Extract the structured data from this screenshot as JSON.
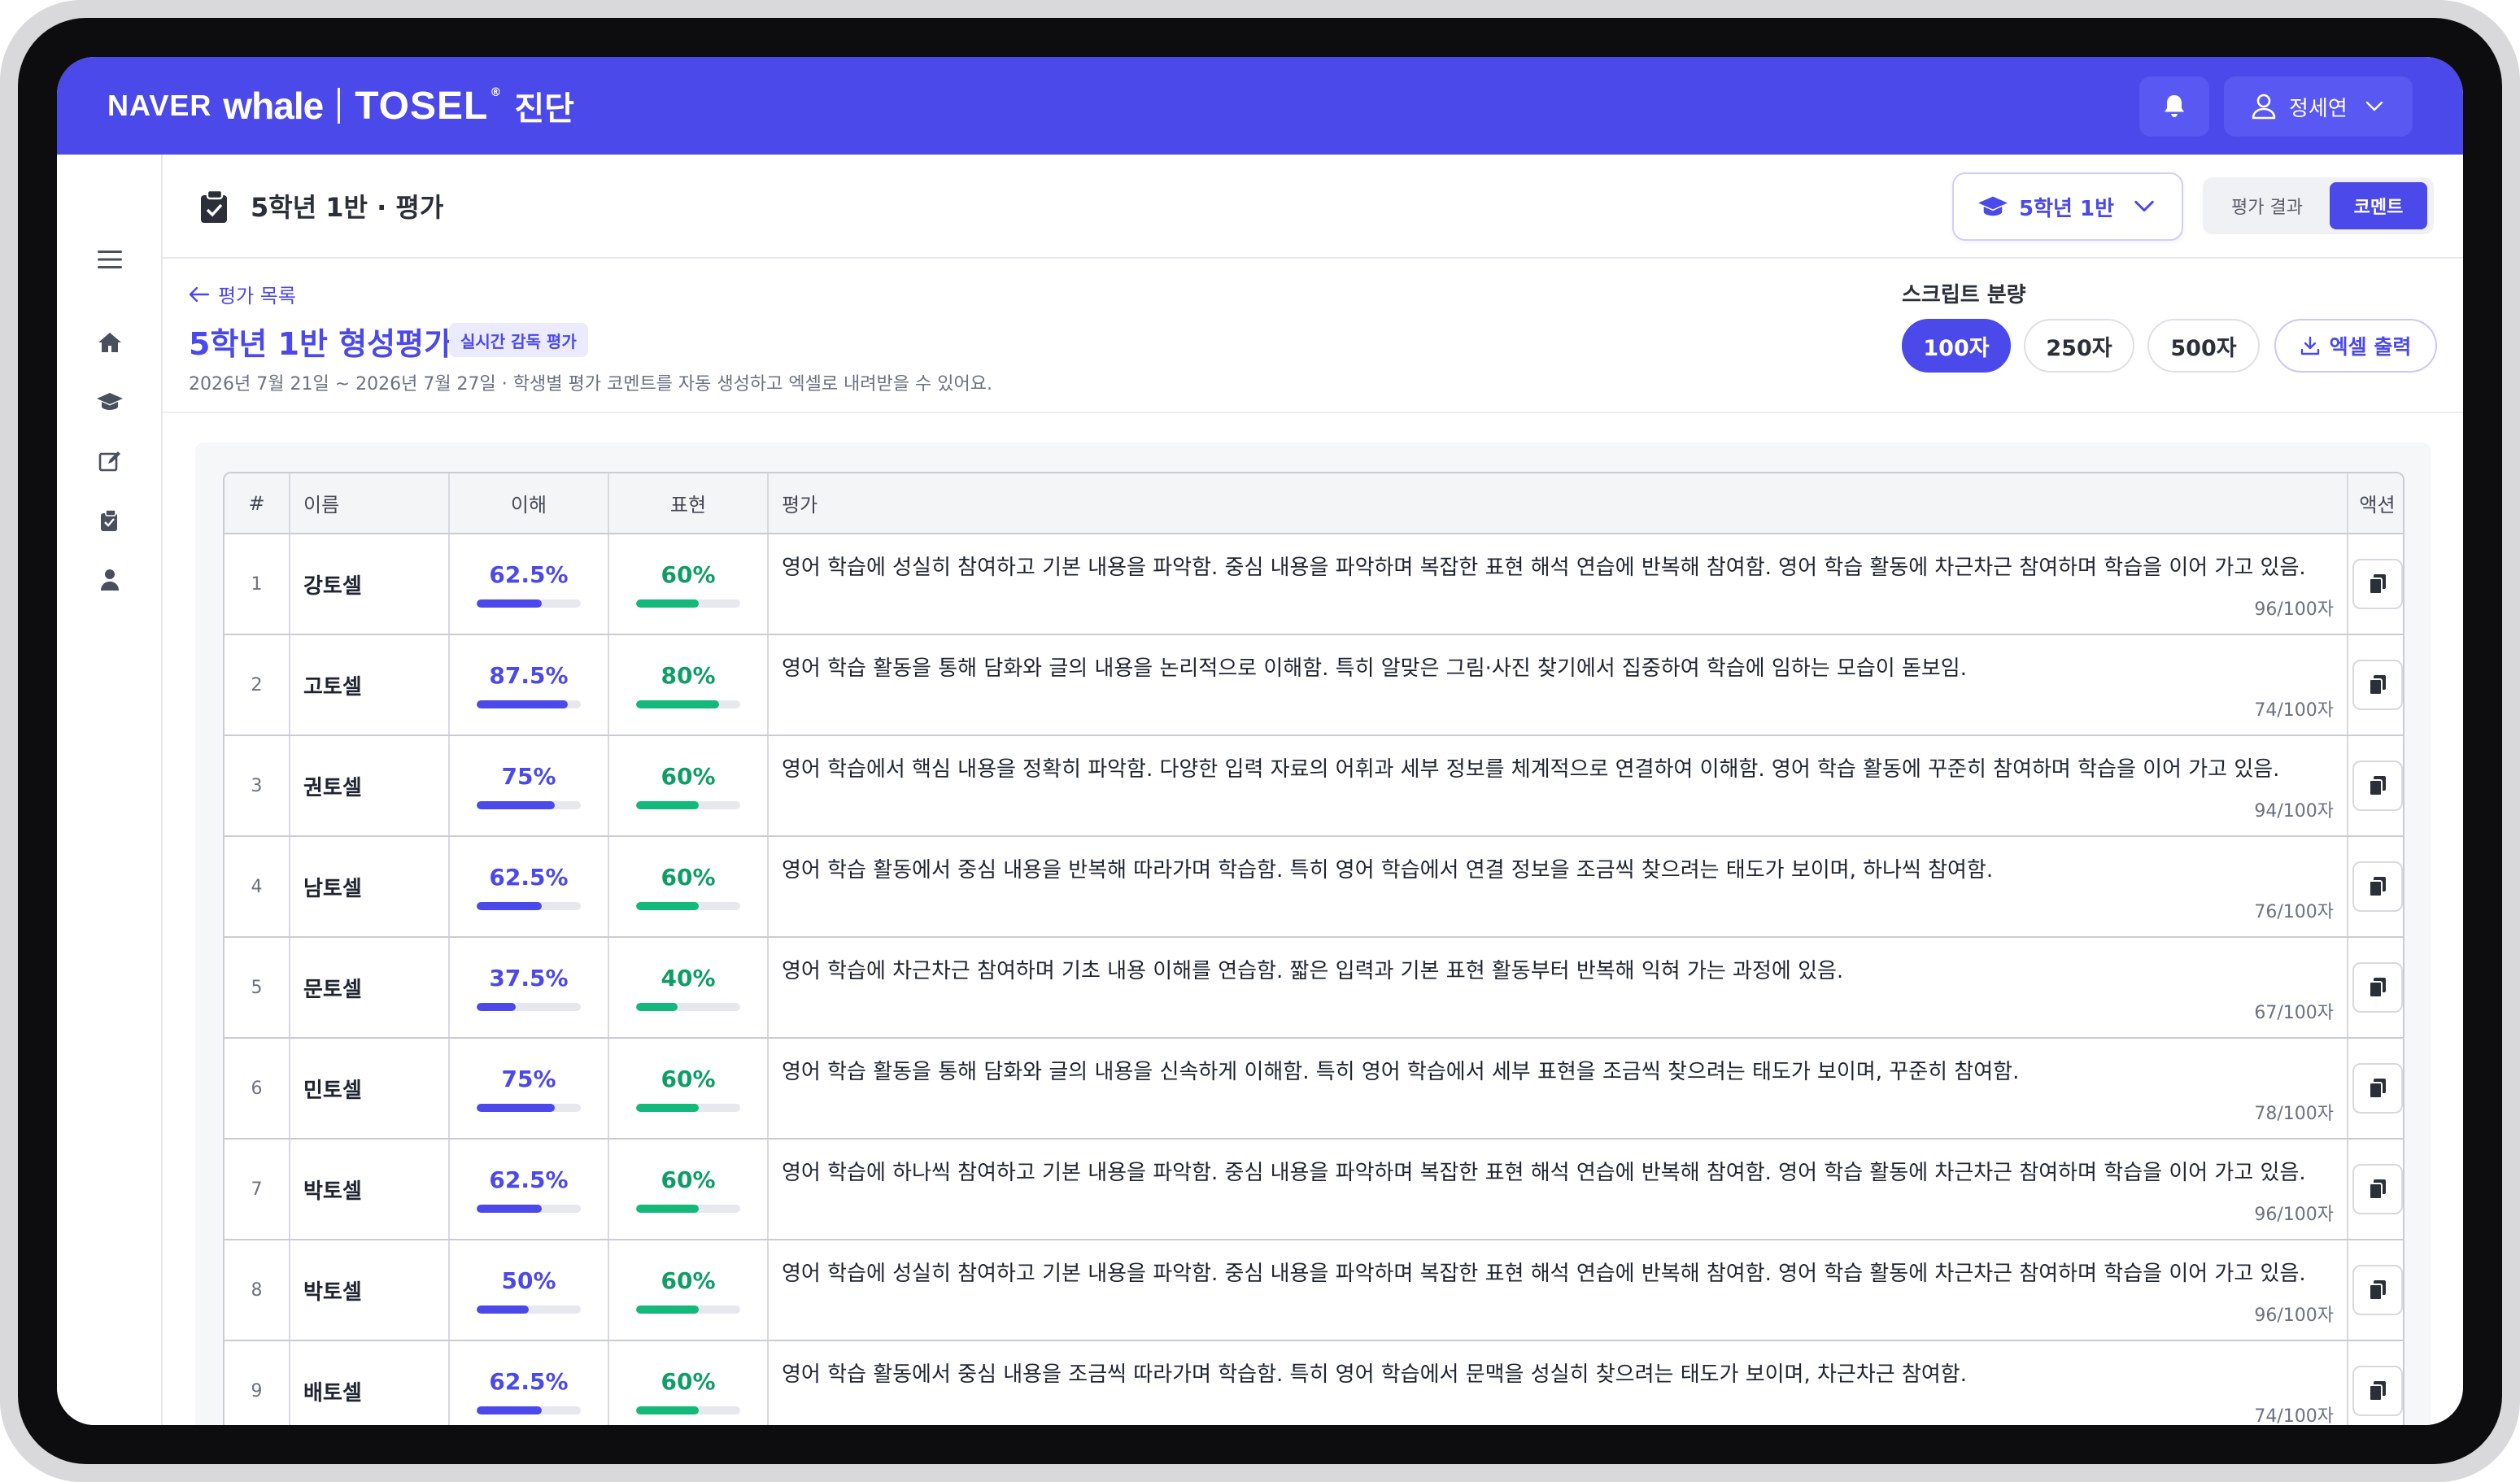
{
  "header": {
    "brand_naver": "NAVER",
    "brand_whale": "whale",
    "brand_tosel": "TOSEL",
    "brand_reg": "®",
    "brand_sub": "진단",
    "user_name": "정세연",
    "icons": {
      "notification": "bell-icon",
      "user": "user-icon",
      "chevron": "chevron-down-icon"
    },
    "accent_color": "#4b49ea"
  },
  "sidebar": {
    "items": [
      "menu-icon",
      "home-icon",
      "graduation-cap-icon",
      "edit-icon",
      "clipboard-icon",
      "person-icon"
    ]
  },
  "page_header": {
    "title": "5학년 1반 · 평가",
    "class_select": "5학년 1반",
    "tabs": [
      {
        "label": "평가 결과",
        "active": false
      },
      {
        "label": "코멘트",
        "active": true
      }
    ]
  },
  "sub_header": {
    "back_link": "평가 목록",
    "title": "5학년 1반 형성평가",
    "badge": "실시간 감독 평가",
    "description": "2026년 7월 21일 ~ 2026년 7월 27일 · 학생별 평가 코멘트를 자동 생성하고 엑셀로 내려받을 수 있어요.",
    "script_label": "스크립트 분량",
    "length_options": [
      {
        "label": "100자",
        "active": true
      },
      {
        "label": "250자",
        "active": false
      },
      {
        "label": "500자",
        "active": false
      }
    ],
    "excel_button": "엑셀 출력"
  },
  "table": {
    "columns": [
      "#",
      "이름",
      "이해",
      "표현",
      "평가",
      "액션"
    ],
    "rows": [
      {
        "num": "1",
        "name": "강토셀",
        "understanding": "62.5%",
        "u_ratio": 0.625,
        "expression": "60%",
        "e_ratio": 0.6,
        "comment": "영어 학습에 성실히 참여하고 기본 내용을 파악함. 중심 내용을 파악하며 복잡한 표현 해석 연습에 반복해 참여함. 영어 학습 활동에 차근차근 참여하며 학습을 이어 가고 있음.",
        "count": "96/100자"
      },
      {
        "num": "2",
        "name": "고토셀",
        "understanding": "87.5%",
        "u_ratio": 0.875,
        "expression": "80%",
        "e_ratio": 0.8,
        "comment": "영어 학습 활동을 통해 담화와 글의 내용을 논리적으로 이해함. 특히 알맞은 그림·사진 찾기에서 집중하여 학습에 임하는 모습이 돋보임.",
        "count": "74/100자"
      },
      {
        "num": "3",
        "name": "권토셀",
        "understanding": "75%",
        "u_ratio": 0.75,
        "expression": "60%",
        "e_ratio": 0.6,
        "comment": "영어 학습에서 핵심 내용을 정확히 파악함. 다양한 입력 자료의 어휘과 세부 정보를 체계적으로 연결하여 이해함. 영어 학습 활동에 꾸준히 참여하며 학습을 이어 가고 있음.",
        "count": "94/100자"
      },
      {
        "num": "4",
        "name": "남토셀",
        "understanding": "62.5%",
        "u_ratio": 0.625,
        "expression": "60%",
        "e_ratio": 0.6,
        "comment": "영어 학습 활동에서 중심 내용을 반복해 따라가며 학습함. 특히 영어 학습에서 연결 정보을 조금씩 찾으려는 태도가 보이며, 하나씩 참여함.",
        "count": "76/100자"
      },
      {
        "num": "5",
        "name": "문토셀",
        "understanding": "37.5%",
        "u_ratio": 0.375,
        "expression": "40%",
        "e_ratio": 0.4,
        "comment": "영어 학습에 차근차근 참여하며 기초 내용 이해를 연습함. 짧은 입력과 기본 표현 활동부터 반복해 익혀 가는 과정에 있음.",
        "count": "67/100자"
      },
      {
        "num": "6",
        "name": "민토셀",
        "understanding": "75%",
        "u_ratio": 0.75,
        "expression": "60%",
        "e_ratio": 0.6,
        "comment": "영어 학습 활동을 통해 담화와 글의 내용을 신속하게 이해함. 특히 영어 학습에서 세부 표현을 조금씩 찾으려는 태도가 보이며, 꾸준히 참여함.",
        "count": "78/100자"
      },
      {
        "num": "7",
        "name": "박토셀",
        "understanding": "62.5%",
        "u_ratio": 0.625,
        "expression": "60%",
        "e_ratio": 0.6,
        "comment": "영어 학습에 하나씩 참여하고 기본 내용을 파악함. 중심 내용을 파악하며 복잡한 표현 해석 연습에 반복해 참여함. 영어 학습 활동에 차근차근 참여하며 학습을 이어 가고 있음.",
        "count": "96/100자"
      },
      {
        "num": "8",
        "name": "박토셀",
        "understanding": "50%",
        "u_ratio": 0.5,
        "expression": "60%",
        "e_ratio": 0.6,
        "comment": "영어 학습에 성실히 참여하고 기본 내용을 파악함. 중심 내용을 파악하며 복잡한 표현 해석 연습에 반복해 참여함. 영어 학습 활동에 차근차근 참여하며 학습을 이어 가고 있음.",
        "count": "96/100자"
      },
      {
        "num": "9",
        "name": "배토셀",
        "understanding": "62.5%",
        "u_ratio": 0.625,
        "expression": "60%",
        "e_ratio": 0.6,
        "comment": "영어 학습 활동에서 중심 내용을 조금씩 따라가며 학습함. 특히 영어 학습에서 문맥을 성실히 찾으려는 태도가 보이며, 차근차근 참여함.",
        "count": "74/100자"
      }
    ]
  }
}
